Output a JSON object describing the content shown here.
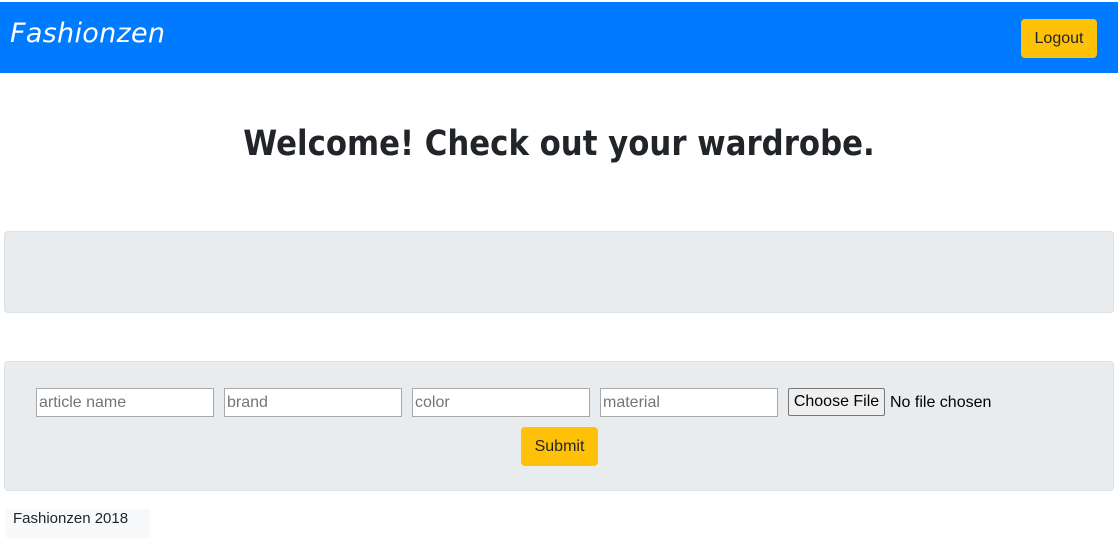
{
  "navbar": {
    "brand": "Fashionzen",
    "logout_label": "Logout",
    "background": "#007bff"
  },
  "main": {
    "heading": "Welcome! Check out your wardrobe."
  },
  "form": {
    "article_placeholder": "article name",
    "brand_placeholder": "brand",
    "color_placeholder": "color",
    "material_placeholder": "material",
    "choose_file_label": "Choose File",
    "file_status": "No file chosen",
    "submit_label": "Submit"
  },
  "footer": {
    "text": "Fashionzen 2018"
  },
  "colors": {
    "primary": "#007bff",
    "warning": "#ffc107",
    "panel": "#e9ecef"
  }
}
